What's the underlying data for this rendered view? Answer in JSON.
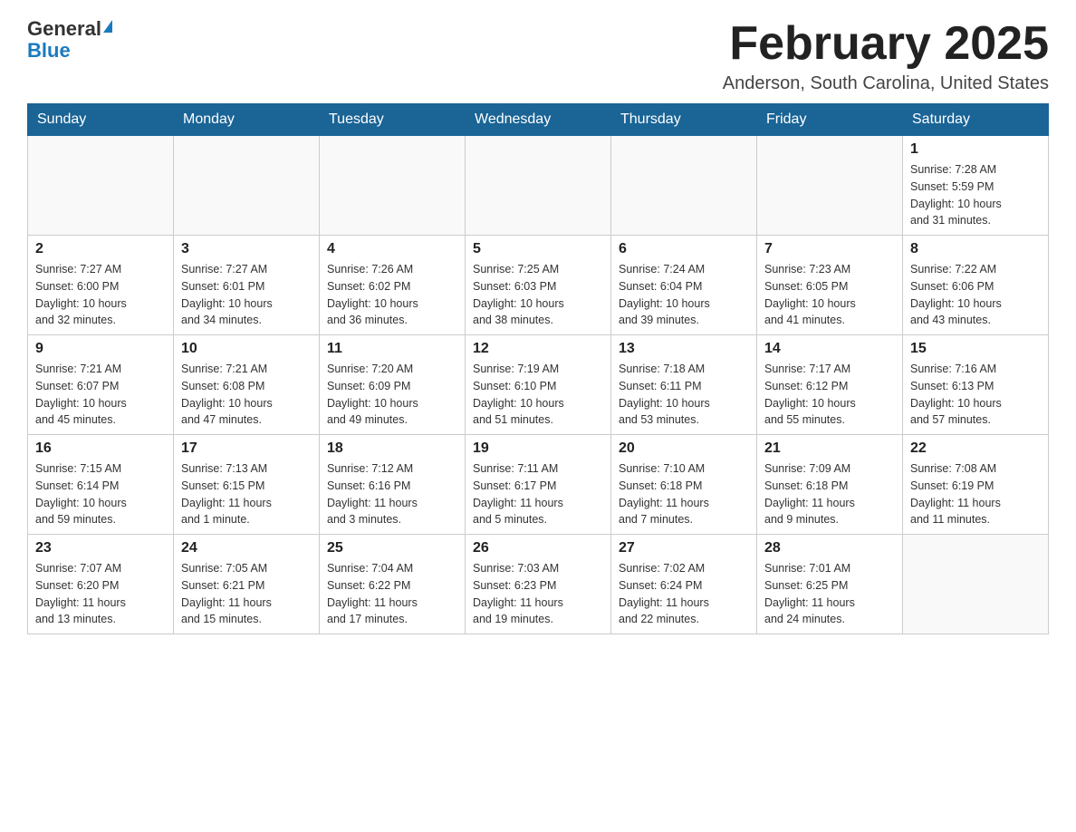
{
  "logo": {
    "text_general": "General",
    "triangle_label": "logo-triangle",
    "text_blue": "Blue"
  },
  "header": {
    "title": "February 2025",
    "subtitle": "Anderson, South Carolina, United States"
  },
  "weekdays": [
    "Sunday",
    "Monday",
    "Tuesday",
    "Wednesday",
    "Thursday",
    "Friday",
    "Saturday"
  ],
  "weeks": [
    {
      "days": [
        {
          "number": "",
          "info": ""
        },
        {
          "number": "",
          "info": ""
        },
        {
          "number": "",
          "info": ""
        },
        {
          "number": "",
          "info": ""
        },
        {
          "number": "",
          "info": ""
        },
        {
          "number": "",
          "info": ""
        },
        {
          "number": "1",
          "info": "Sunrise: 7:28 AM\nSunset: 5:59 PM\nDaylight: 10 hours\nand 31 minutes."
        }
      ]
    },
    {
      "days": [
        {
          "number": "2",
          "info": "Sunrise: 7:27 AM\nSunset: 6:00 PM\nDaylight: 10 hours\nand 32 minutes."
        },
        {
          "number": "3",
          "info": "Sunrise: 7:27 AM\nSunset: 6:01 PM\nDaylight: 10 hours\nand 34 minutes."
        },
        {
          "number": "4",
          "info": "Sunrise: 7:26 AM\nSunset: 6:02 PM\nDaylight: 10 hours\nand 36 minutes."
        },
        {
          "number": "5",
          "info": "Sunrise: 7:25 AM\nSunset: 6:03 PM\nDaylight: 10 hours\nand 38 minutes."
        },
        {
          "number": "6",
          "info": "Sunrise: 7:24 AM\nSunset: 6:04 PM\nDaylight: 10 hours\nand 39 minutes."
        },
        {
          "number": "7",
          "info": "Sunrise: 7:23 AM\nSunset: 6:05 PM\nDaylight: 10 hours\nand 41 minutes."
        },
        {
          "number": "8",
          "info": "Sunrise: 7:22 AM\nSunset: 6:06 PM\nDaylight: 10 hours\nand 43 minutes."
        }
      ]
    },
    {
      "days": [
        {
          "number": "9",
          "info": "Sunrise: 7:21 AM\nSunset: 6:07 PM\nDaylight: 10 hours\nand 45 minutes."
        },
        {
          "number": "10",
          "info": "Sunrise: 7:21 AM\nSunset: 6:08 PM\nDaylight: 10 hours\nand 47 minutes."
        },
        {
          "number": "11",
          "info": "Sunrise: 7:20 AM\nSunset: 6:09 PM\nDaylight: 10 hours\nand 49 minutes."
        },
        {
          "number": "12",
          "info": "Sunrise: 7:19 AM\nSunset: 6:10 PM\nDaylight: 10 hours\nand 51 minutes."
        },
        {
          "number": "13",
          "info": "Sunrise: 7:18 AM\nSunset: 6:11 PM\nDaylight: 10 hours\nand 53 minutes."
        },
        {
          "number": "14",
          "info": "Sunrise: 7:17 AM\nSunset: 6:12 PM\nDaylight: 10 hours\nand 55 minutes."
        },
        {
          "number": "15",
          "info": "Sunrise: 7:16 AM\nSunset: 6:13 PM\nDaylight: 10 hours\nand 57 minutes."
        }
      ]
    },
    {
      "days": [
        {
          "number": "16",
          "info": "Sunrise: 7:15 AM\nSunset: 6:14 PM\nDaylight: 10 hours\nand 59 minutes."
        },
        {
          "number": "17",
          "info": "Sunrise: 7:13 AM\nSunset: 6:15 PM\nDaylight: 11 hours\nand 1 minute."
        },
        {
          "number": "18",
          "info": "Sunrise: 7:12 AM\nSunset: 6:16 PM\nDaylight: 11 hours\nand 3 minutes."
        },
        {
          "number": "19",
          "info": "Sunrise: 7:11 AM\nSunset: 6:17 PM\nDaylight: 11 hours\nand 5 minutes."
        },
        {
          "number": "20",
          "info": "Sunrise: 7:10 AM\nSunset: 6:18 PM\nDaylight: 11 hours\nand 7 minutes."
        },
        {
          "number": "21",
          "info": "Sunrise: 7:09 AM\nSunset: 6:18 PM\nDaylight: 11 hours\nand 9 minutes."
        },
        {
          "number": "22",
          "info": "Sunrise: 7:08 AM\nSunset: 6:19 PM\nDaylight: 11 hours\nand 11 minutes."
        }
      ]
    },
    {
      "days": [
        {
          "number": "23",
          "info": "Sunrise: 7:07 AM\nSunset: 6:20 PM\nDaylight: 11 hours\nand 13 minutes."
        },
        {
          "number": "24",
          "info": "Sunrise: 7:05 AM\nSunset: 6:21 PM\nDaylight: 11 hours\nand 15 minutes."
        },
        {
          "number": "25",
          "info": "Sunrise: 7:04 AM\nSunset: 6:22 PM\nDaylight: 11 hours\nand 17 minutes."
        },
        {
          "number": "26",
          "info": "Sunrise: 7:03 AM\nSunset: 6:23 PM\nDaylight: 11 hours\nand 19 minutes."
        },
        {
          "number": "27",
          "info": "Sunrise: 7:02 AM\nSunset: 6:24 PM\nDaylight: 11 hours\nand 22 minutes."
        },
        {
          "number": "28",
          "info": "Sunrise: 7:01 AM\nSunset: 6:25 PM\nDaylight: 11 hours\nand 24 minutes."
        },
        {
          "number": "",
          "info": ""
        }
      ]
    }
  ]
}
